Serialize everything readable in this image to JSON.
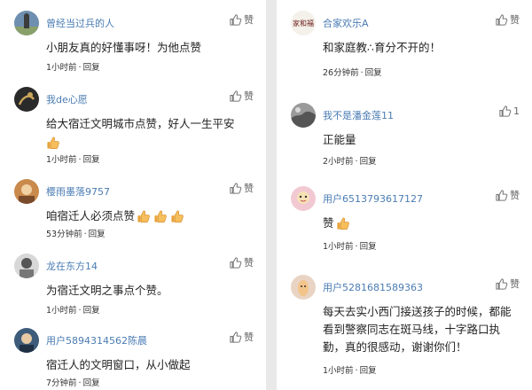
{
  "left": [
    {
      "user": "曾经当过兵的人",
      "text": "小朋友真的好懂事呀！为他点赞",
      "time": "1小时前",
      "reply": "回复",
      "like": "赞",
      "emoji_count": 0
    },
    {
      "user": "我de心愿",
      "text": "给大宿迁文明城市点赞，好人一生平安",
      "time": "1小时前",
      "reply": "回复",
      "like": "赞",
      "emoji_count": 1
    },
    {
      "user": "樱雨墨落9757",
      "text": "咱宿迁人必须点赞",
      "time": "53分钟前",
      "reply": "回复",
      "like": "赞",
      "emoji_count": 3
    },
    {
      "user": "龙在东方14",
      "text": "为宿迁文明之事点个赞。",
      "time": "1小时前",
      "reply": "回复",
      "like": "赞",
      "emoji_count": 0
    },
    {
      "user": "用户5894314562陈晨",
      "text": "宿迁人的文明窗口，从小做起",
      "time": "7分钟前",
      "reply": "回复",
      "like": "赞",
      "emoji_count": 0
    }
  ],
  "right": [
    {
      "user": "合家欢乐A",
      "text": "和家庭教∴育分不开的！",
      "time": "26分钟前",
      "reply": "回复",
      "like": "赞",
      "emoji_count": 0,
      "avatar_text": "家和福"
    },
    {
      "user": "我不是潘金莲11",
      "text": "正能量",
      "time": "2小时前",
      "reply": "回复",
      "like": "1",
      "emoji_count": 0
    },
    {
      "user": "用户6513793617127",
      "text": "赞",
      "time": "1小时前",
      "reply": "回复",
      "like": "赞",
      "emoji_count": 1
    },
    {
      "user": "用户5281681589363",
      "text": "每天去实小西门接送孩子的时候，都能看到警察同志在斑马线，十字路口执勤，真的很感动，谢谢你们！",
      "time": "1小时前",
      "reply": "回复",
      "like": "赞",
      "emoji_count": 0
    }
  ],
  "colors": {
    "username": "#4a7cb3",
    "text": "#222222",
    "meta": "#333333",
    "emoji": "#f3b04a"
  }
}
